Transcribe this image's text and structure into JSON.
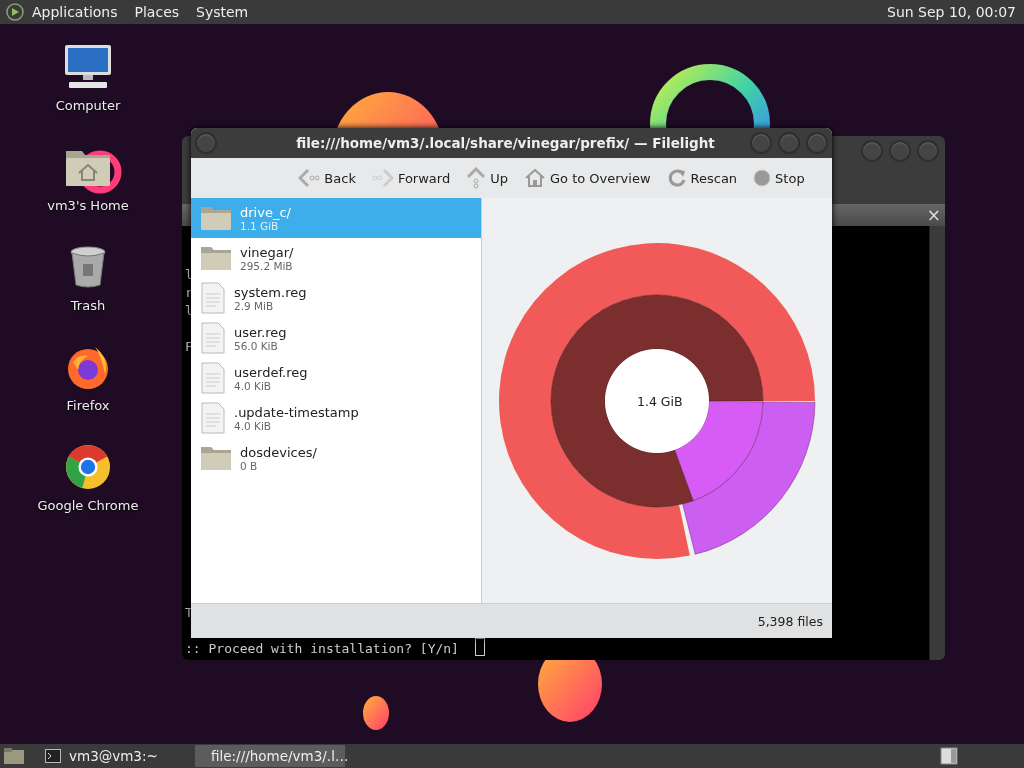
{
  "top_panel": {
    "menus": [
      "Applications",
      "Places",
      "System"
    ],
    "clock": "Sun Sep 10, 00:07"
  },
  "desktop_icons": [
    {
      "label": "Computer",
      "kind": "computer"
    },
    {
      "label": "vm3's Home",
      "kind": "home"
    },
    {
      "label": "Trash",
      "kind": "trash"
    },
    {
      "label": "Firefox",
      "kind": "firefox"
    },
    {
      "label": "Google Chrome",
      "kind": "chrome"
    }
  ],
  "terminal": {
    "close_label": "×",
    "upper_lines": [
      "l",
      "r",
      "l",
      "F"
    ],
    "lower_lines": [
      "T",
      ":: Proceed with installation? [Y/n]"
    ]
  },
  "filelight": {
    "title": "file:///home/vm3/.local/share/vinegar/prefix/ — Filelight",
    "toolbar": [
      {
        "label": "Back",
        "kind": "back"
      },
      {
        "label": "Forward",
        "kind": "forward"
      },
      {
        "label": "Up",
        "kind": "up"
      },
      {
        "label": "Go to Overview",
        "kind": "overview"
      },
      {
        "label": "Rescan",
        "kind": "rescan"
      },
      {
        "label": "Stop",
        "kind": "stop"
      }
    ],
    "files": [
      {
        "name": "drive_c/",
        "size": "1.1 GiB",
        "kind": "folder",
        "selected": true
      },
      {
        "name": "vinegar/",
        "size": "295.2 MiB",
        "kind": "folder",
        "selected": false
      },
      {
        "name": "system.reg",
        "size": "2.9 MiB",
        "kind": "file",
        "selected": false
      },
      {
        "name": "user.reg",
        "size": "56.0 KiB",
        "kind": "file",
        "selected": false
      },
      {
        "name": "userdef.reg",
        "size": "4.0 KiB",
        "kind": "file",
        "selected": false
      },
      {
        "name": ".update-timestamp",
        "size": "4.0 KiB",
        "kind": "file",
        "selected": false
      },
      {
        "name": "dosdevices/",
        "size": "0 B",
        "kind": "folder",
        "selected": false
      }
    ],
    "center_label": "1.4 GiB",
    "status": "5,398 files"
  },
  "taskbar": {
    "tasks": [
      {
        "label": "vm3@vm3:~",
        "kind": "terminal",
        "selected": false
      },
      {
        "label": "file:///home/vm3/.l…",
        "kind": "filelight",
        "selected": true
      }
    ]
  }
}
